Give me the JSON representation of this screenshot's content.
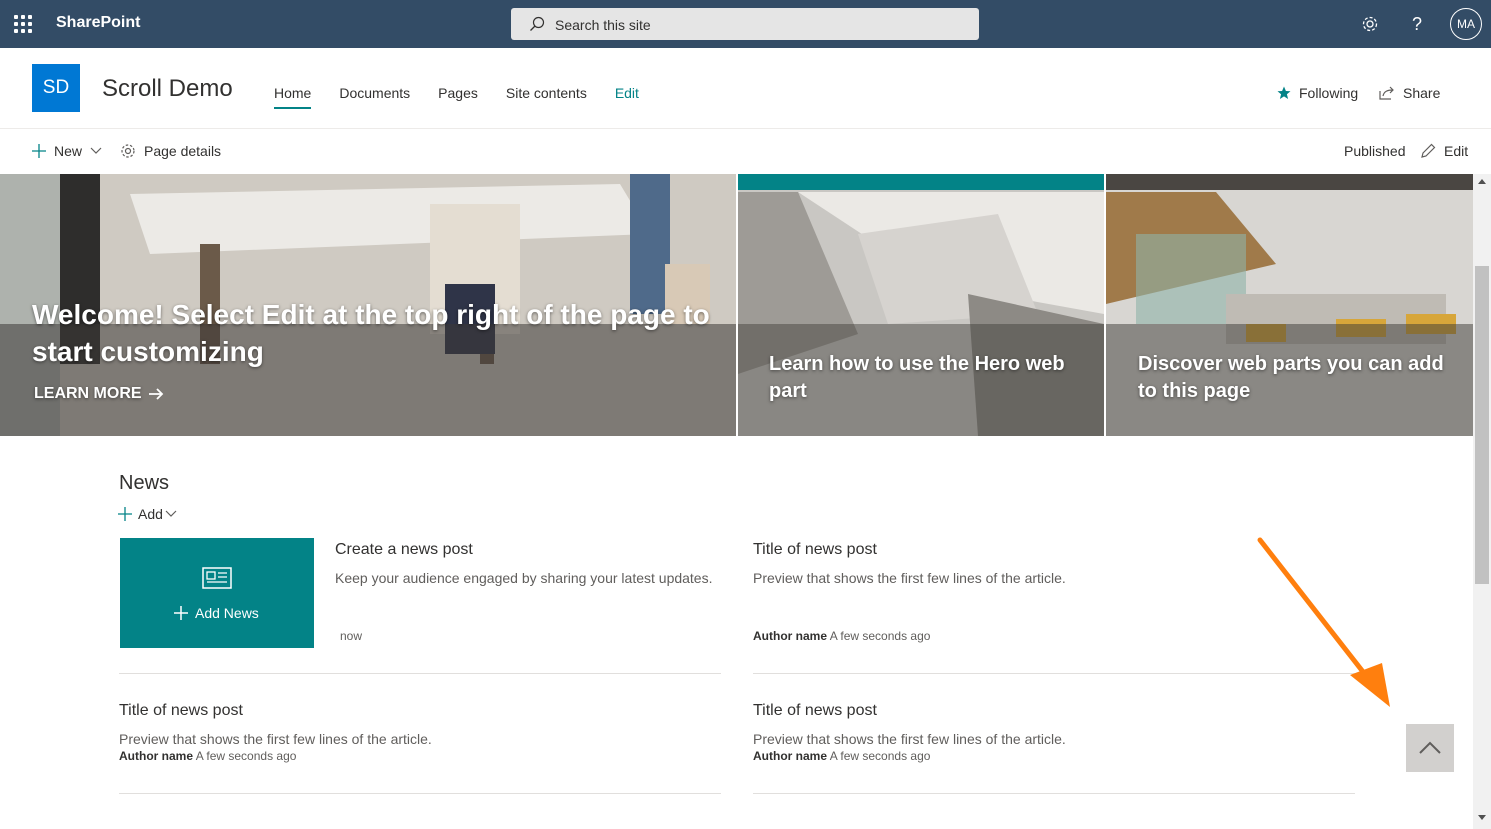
{
  "suite": {
    "app_name": "SharePoint",
    "search_placeholder": "Search this site",
    "avatar_initials": "MA",
    "icons": [
      "app-launcher-icon",
      "search-icon",
      "settings-icon",
      "help-icon"
    ]
  },
  "site": {
    "logo_initials": "SD",
    "title": "Scroll Demo",
    "nav": [
      "Home",
      "Documents",
      "Pages",
      "Site contents",
      "Edit"
    ],
    "following_label": "Following",
    "share_label": "Share"
  },
  "commandbar": {
    "new_label": "New",
    "page_details_label": "Page details",
    "status": "Published",
    "edit_label": "Edit"
  },
  "hero": {
    "main_title": "Welcome! Select Edit at the top right of the page to start customizing",
    "main_link": "LEARN MORE",
    "tile2_title": "Learn how to use the Hero web part",
    "tile3_title": "Discover web parts you can add to this page"
  },
  "news": {
    "heading": "News",
    "add_label": "Add",
    "add_news_label": "Add News",
    "posts": [
      {
        "title": "Create a news post",
        "preview": "Keep your audience engaged by sharing your latest updates.",
        "author": "",
        "time": "now"
      },
      {
        "title": "Title of news post",
        "preview": "Preview that shows the first few lines of the article.",
        "author": "Author name",
        "time": "A few seconds ago"
      },
      {
        "title": "Title of news post",
        "preview": "Preview that shows the first few lines of the article.",
        "author": "Author name",
        "time": "A few seconds ago"
      },
      {
        "title": "Title of news post",
        "preview": "Preview that shows the first few lines of the article.",
        "author": "Author name",
        "time": "A few seconds ago"
      }
    ]
  },
  "colors": {
    "suitebar": "#334c66",
    "accent": "#038387",
    "logo": "#0078d4",
    "annotation_arrow": "#ff7f0e"
  }
}
